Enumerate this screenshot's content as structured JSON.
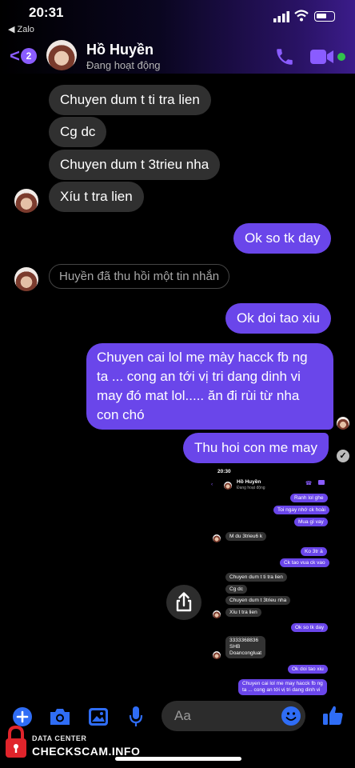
{
  "status_bar": {
    "time": "20:31",
    "back_app": "Zalo"
  },
  "header": {
    "unread_count": "2",
    "contact_name": "Hồ Huyền",
    "contact_status": "Đang hoạt động"
  },
  "messages": [
    {
      "dir": "in",
      "text": "Chuyen dum t ti tra lien"
    },
    {
      "dir": "in",
      "text": "Cg dc"
    },
    {
      "dir": "in",
      "text": "Chuyen dum t 3trieu nha"
    },
    {
      "dir": "in",
      "text": "Xíu t tra lien"
    },
    {
      "dir": "out",
      "text": "Ok so tk day"
    },
    {
      "dir": "system",
      "text": "Huyền đã thu hồi một tin nhắn"
    },
    {
      "dir": "out",
      "text": "Ok doi tao xiu"
    },
    {
      "dir": "out",
      "lines": [
        "Chuyen cai lol mẹ mày hacck fb ng",
        "ta ... cong an tới vị tri dang dinh vi",
        "may đó mat lol..... ăn đi rùi từ nha",
        "con chó"
      ]
    },
    {
      "dir": "out",
      "text": "Thu hoi con me may"
    }
  ],
  "embedded_screenshot": {
    "time": "20:30",
    "contact_name": "Hồ Huyền",
    "contact_status": "Đang hoạt động",
    "messages": [
      {
        "dir": "out",
        "text": "Ranh lol ghe"
      },
      {
        "dir": "out",
        "text": "Toi ngay nhớ ck hoài"
      },
      {
        "dir": "out",
        "text": "Mua gì vay"
      },
      {
        "dir": "in",
        "text": "M du 3trieu6 k"
      },
      {
        "dir": "out",
        "text": "Ko 3tr à"
      },
      {
        "dir": "out",
        "text": "Ck tao vua ck vao"
      },
      {
        "dir": "in",
        "text": "Chuyen dum t ti tra lien"
      },
      {
        "dir": "in",
        "text": "Cg dc"
      },
      {
        "dir": "in",
        "text": "Chuyen dum t 3trieu nha"
      },
      {
        "dir": "in",
        "text": "Xíu t tra lien"
      },
      {
        "dir": "out",
        "text": "Ok so tk day"
      },
      {
        "dir": "in",
        "lines": [
          "3333368836",
          "SHB",
          "Doancongluat"
        ]
      },
      {
        "dir": "out",
        "text": "Ok doi tao xiu"
      },
      {
        "dir": "out",
        "lines": [
          "Chuyen cai lol me may hacck fb ng",
          "ta ... cong an tới vị tri dang dinh vi"
        ]
      }
    ]
  },
  "composer": {
    "placeholder": "Aa"
  },
  "watermark": {
    "top": "DATA CENTER",
    "main": "CHECKSCAM.INFO"
  },
  "colors": {
    "outgoing_bubble": "#6a46ea",
    "incoming_bubble": "#303030",
    "accent": "#8a5cff",
    "online": "#31c24c"
  },
  "icons": [
    "signal-icon",
    "wifi-icon",
    "battery-icon",
    "chevron-left-icon",
    "phone-icon",
    "video-icon",
    "share-icon",
    "plus-icon",
    "camera-icon",
    "image-icon",
    "mic-icon",
    "emoji-icon",
    "thumbs-up-icon",
    "lock-icon"
  ]
}
